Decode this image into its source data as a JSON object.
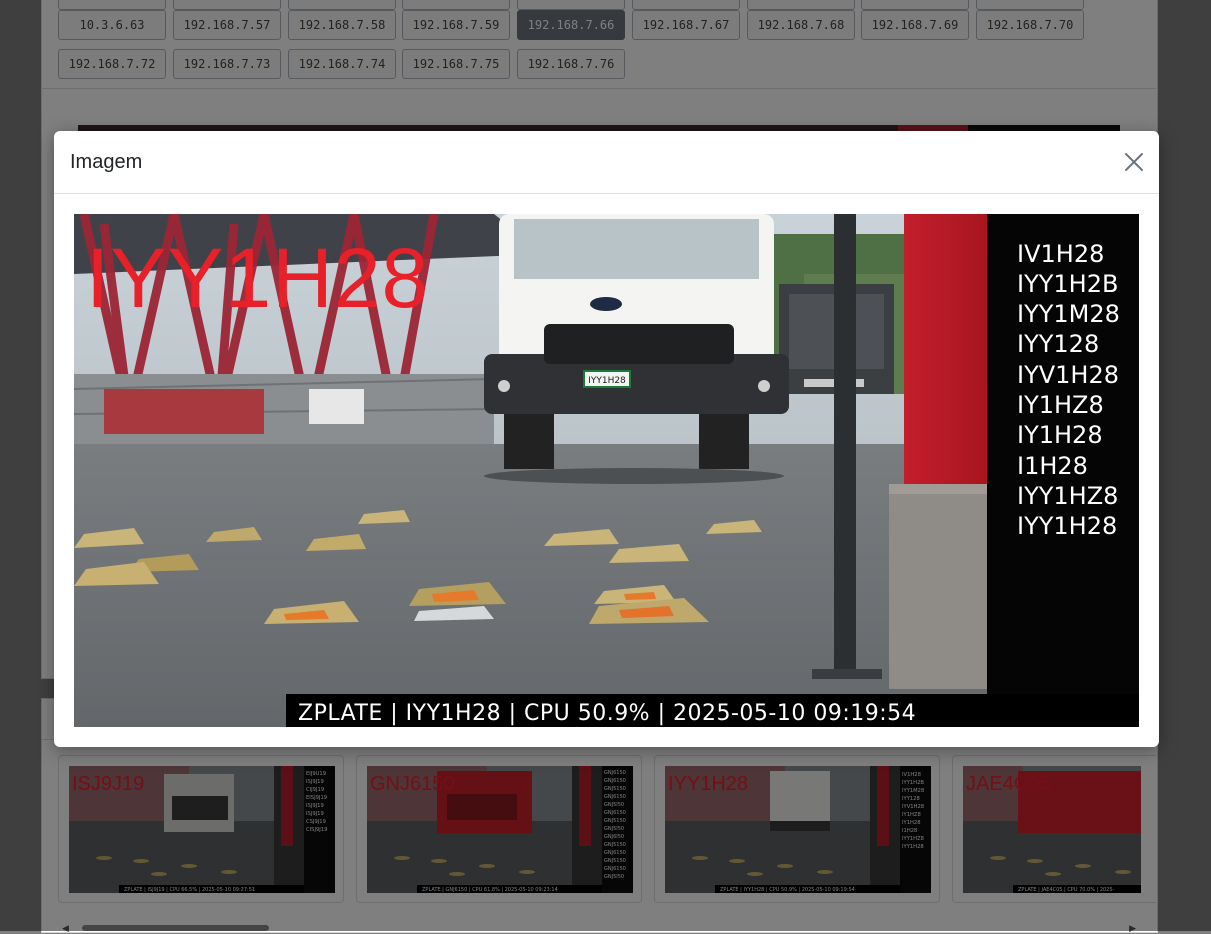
{
  "ip_buttons": {
    "row1": [
      "10.3.6.63",
      "192.168.7.57",
      "192.168.7.58",
      "192.168.7.59",
      "192.168.7.66",
      "192.168.7.67",
      "192.168.7.68",
      "192.168.7.69",
      "192.168.7.70"
    ],
    "row2": [
      "192.168.7.72",
      "192.168.7.73",
      "192.168.7.74",
      "192.168.7.75",
      "192.168.7.76"
    ],
    "active": "192.168.7.66"
  },
  "modal": {
    "title": "Imagem",
    "image": {
      "plate": "IYY1H28",
      "candidates": [
        "IV1H28",
        "IYY1H2B",
        "IYY1M28",
        "IYY128",
        "IYV1H28",
        "IY1HZ8",
        "IY1H28",
        "I1H28",
        "IYY1HZ8",
        "IYY1H28"
      ],
      "osd": "ZPLATE | IYY1H28 | CPU 50.9% | 2025-05-10 09:19:54",
      "truck_plate": "IYY1H28"
    }
  },
  "thumbnails": [
    {
      "plate": "ISJ9J19",
      "candidates": [
        "EIJ9U19",
        "ISJ9J19",
        "CIJ9J19",
        "EISJ9J19",
        "ISJ9J19",
        "ISJ9J19",
        "CSJ9J19",
        "CISJ9J19"
      ],
      "osd": "ZPLATE | ISJ9J19 | CPU 66.5% | 2025-05-10 09:27:51"
    },
    {
      "plate": "GNJ6150",
      "candidates": [
        "GNJ6150",
        "GNJ6150",
        "GNJ5150",
        "GNJ6150",
        "GNJ5I50",
        "GNJ6150",
        "GNJ5150",
        "GNJ5I50",
        "GNJ6I50",
        "GNJ5150",
        "GNJ6150",
        "GNJ5150",
        "GNJ6150",
        "GNJ5I50"
      ],
      "osd": "ZPLATE | GNJ6150 | CPU 61.8% | 2025-05-10 09:23:14"
    },
    {
      "plate": "IYY1H28",
      "candidates": [
        "IV1H28",
        "IYY1H2B",
        "IYY1M28",
        "IYY128",
        "IYV1H28",
        "IY1HZ8",
        "IY1H28",
        "I1H28",
        "IYY1HZ8",
        "IYY1H28"
      ],
      "osd": "ZPLATE | IYY1H28 | CPU 50.9% | 2025-05-10 09:19:54"
    },
    {
      "plate": "JAE4C05",
      "candidates": [],
      "osd": "ZPLATE | JAE4C05 | CPU 70.0% | 2025-"
    }
  ],
  "icons": {
    "close": "close-icon",
    "scroll_left": "scroll-left-icon",
    "scroll_right": "scroll-right-icon"
  },
  "colors": {
    "plate_red": "#e8202a",
    "active_button": "#6c757d",
    "backdrop": "#000000"
  }
}
